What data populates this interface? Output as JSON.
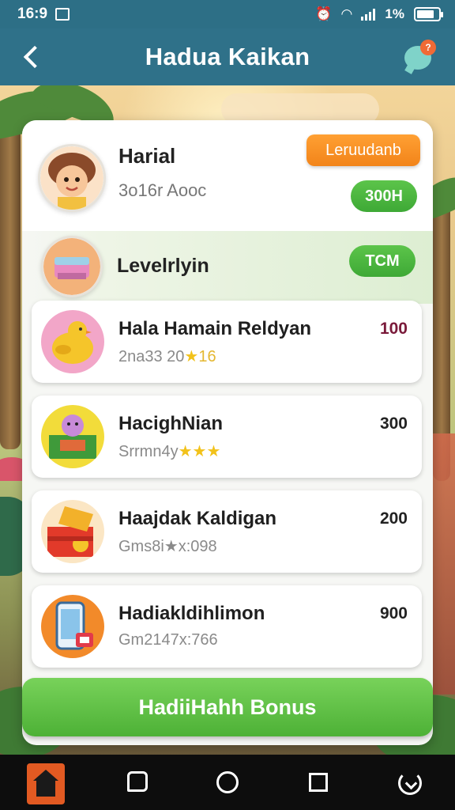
{
  "status_bar": {
    "time": "16:9",
    "battery_text": "1%"
  },
  "header": {
    "title": "Hadua Kaikan",
    "chat_badge": "?"
  },
  "profile": {
    "name": "Harial",
    "subtitle": "3o16r Aooc",
    "top_button": "Leruudanb",
    "points_pill": "300H"
  },
  "level": {
    "label": "Levelrlyin",
    "pill": "TCM"
  },
  "rewards": [
    {
      "title": "Hala Hamain Reldyan",
      "sub_text": "2na33 20",
      "sub_stars": "★",
      "sub_tail": "16",
      "value": "100",
      "value_color": "#7a1a3a"
    },
    {
      "title": "HacighNian",
      "sub_text": "Srrmn4y",
      "sub_stars": "★★★",
      "sub_tail": "",
      "value": "300",
      "value_color": "#222222"
    },
    {
      "title": "Haajdak Kaldigan",
      "sub_text": "Gms8i",
      "sub_stars": "★x:",
      "sub_tail": "098",
      "value": "200",
      "value_color": "#222222"
    },
    {
      "title": "Hadiakldihlimon",
      "sub_text": "Gm2147",
      "sub_stars": "x:",
      "sub_tail": "766",
      "value": "900",
      "value_color": "#222222"
    }
  ],
  "bonus_button": "HadiiHahh Bonus",
  "icons": {
    "back": "chevron-left-icon",
    "chat": "chat-bubble-icon",
    "nav": [
      "home-icon",
      "message-icon",
      "circle-home-icon",
      "square-recent-icon",
      "refresh-icon"
    ]
  },
  "colors": {
    "header": "#2f7189",
    "accent_orange": "#f2841a",
    "accent_green": "#4db136"
  }
}
